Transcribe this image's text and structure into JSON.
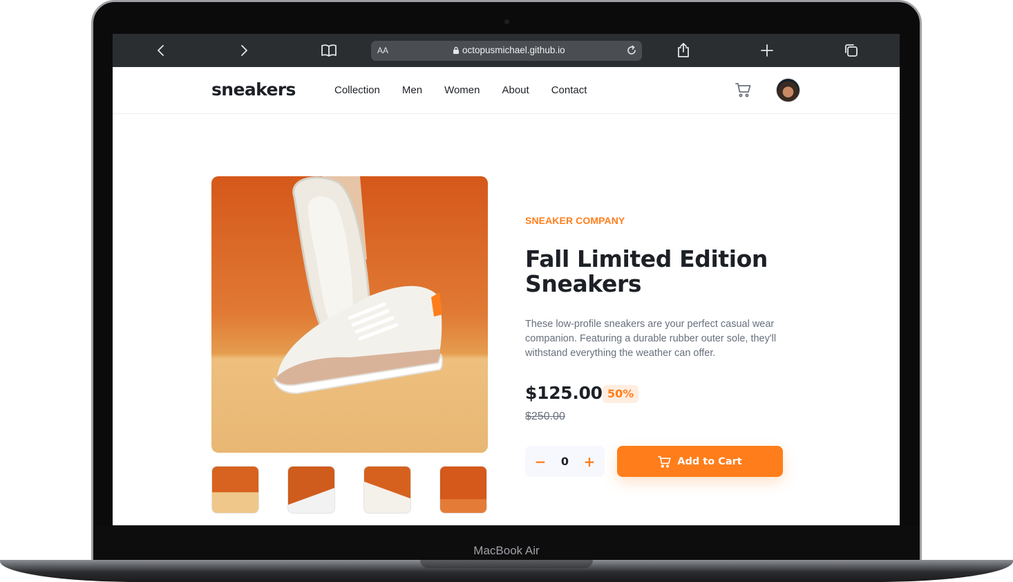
{
  "browser": {
    "aa_label": "AA",
    "url": "octopusmichael.github.io"
  },
  "site": {
    "logo": "sneakers",
    "nav": [
      "Collection",
      "Men",
      "Women",
      "About",
      "Contact"
    ]
  },
  "product": {
    "company": "SNEAKER COMPANY",
    "title": "Fall Limited Edition Sneakers",
    "description": "These low-profile sneakers are your perfect casual wear companion. Featuring a durable rubber outer sole, they'll withstand everything the weather can offer.",
    "price": "$125.00",
    "discount": "50%",
    "original_price": "$250.00",
    "quantity": "0",
    "minus_label": "−",
    "plus_label": "+",
    "add_to_cart_label": "Add to Cart"
  },
  "device": {
    "label": "MacBook Air"
  },
  "colors": {
    "accent": "#ff7e1b",
    "text_dark": "#1d2026",
    "text_muted": "#68707d"
  }
}
